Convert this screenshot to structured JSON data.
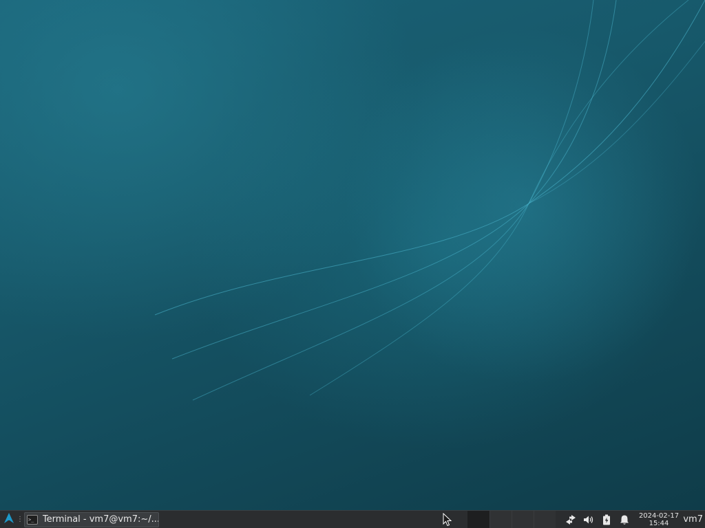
{
  "colors": {
    "wallpaper_light": "#1a6378",
    "wallpaper_dark": "#0f3c49",
    "panel_background": "#2b2d2f",
    "accent": "#1d99c9"
  },
  "panel": {
    "menu_icon": "arch-logo-icon",
    "tasks": [
      {
        "label": "Terminal - vm7@vm7:~/...",
        "icon": "terminal-icon"
      }
    ],
    "workspace_count": 4,
    "active_workspace": 1,
    "tray": [
      {
        "name": "network-icon"
      },
      {
        "name": "volume-icon"
      },
      {
        "name": "battery-icon"
      },
      {
        "name": "notification-bell-icon"
      }
    ],
    "clock": {
      "date": "2024-02-17",
      "time": "15:44"
    },
    "user": "vm7"
  }
}
